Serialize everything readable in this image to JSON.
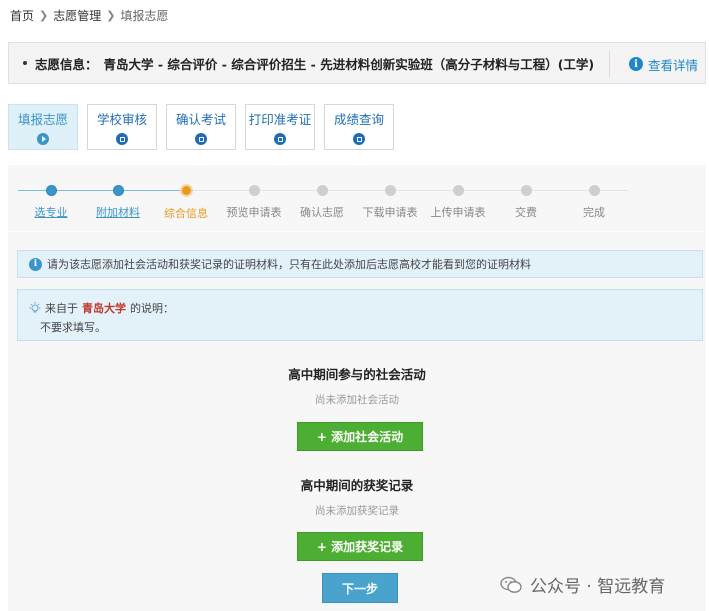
{
  "breadcrumb": {
    "home": "首页",
    "manage": "志愿管理",
    "current": "填报志愿"
  },
  "info": {
    "label": "志愿信息：",
    "value": "青岛大学 - 综合评价 - 综合评价招生 - 先进材料创新实验班（高分子材料与工程）(工学)",
    "detail": "查看详情"
  },
  "tabs": [
    {
      "label": "填报志愿",
      "icon": "play-icon"
    },
    {
      "label": "学校审核",
      "icon": "lock-icon"
    },
    {
      "label": "确认考试",
      "icon": "lock-icon"
    },
    {
      "label": "打印准考证",
      "icon": "lock-icon"
    },
    {
      "label": "成绩查询",
      "icon": "lock-icon"
    }
  ],
  "steps": [
    {
      "label": "选专业",
      "state": "done"
    },
    {
      "label": "附加材料",
      "state": "done"
    },
    {
      "label": "综合信息",
      "state": "current"
    },
    {
      "label": "预览申请表",
      "state": "todo"
    },
    {
      "label": "确认志愿",
      "state": "todo"
    },
    {
      "label": "下载申请表",
      "state": "todo"
    },
    {
      "label": "上传申请表",
      "state": "todo"
    },
    {
      "label": "交费",
      "state": "todo"
    },
    {
      "label": "完成",
      "state": "todo"
    }
  ],
  "notice": "请为该志愿添加社会活动和获奖记录的证明材料，只有在此处添加后志愿高校才能看到您的证明材料",
  "note": {
    "prefix": "来自于",
    "school": "青岛大学",
    "suffix": "的说明：",
    "body": "不要求填写。"
  },
  "activities": {
    "title": "高中期间参与的社会活动",
    "empty": "尚未添加社会活动",
    "button": "+ 添加社会活动"
  },
  "awards": {
    "title": "高中期间的获奖记录",
    "empty": "尚未添加获奖记录",
    "button": "+ 添加获奖记录"
  },
  "next_button": "下一步",
  "watermark": "公众号 · 智远教育",
  "colors": {
    "primary": "#3a95c9",
    "current": "#e89a23",
    "green": "#4cae32",
    "school": "#c0392b"
  }
}
